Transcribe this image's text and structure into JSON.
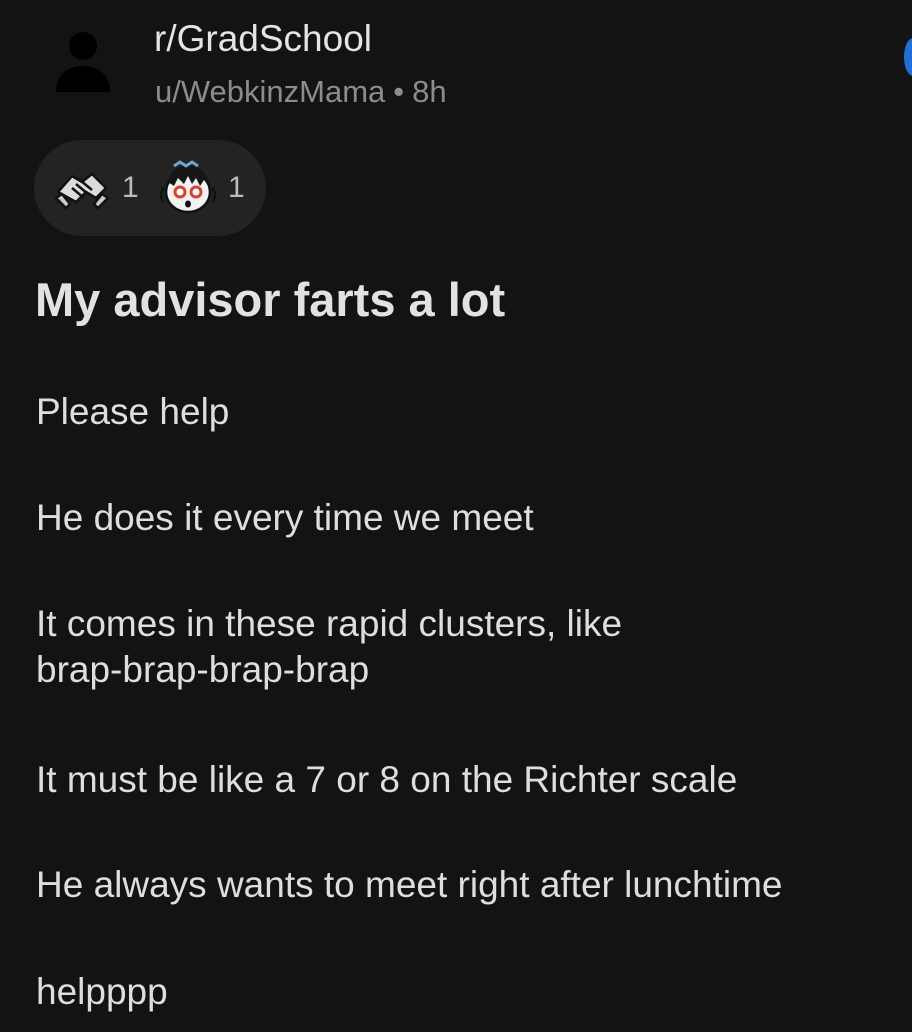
{
  "post": {
    "subreddit": "r/GradSchool",
    "author": "u/WebkinzMama",
    "separator": "•",
    "age": "8h",
    "title": "My advisor farts a lot",
    "body": [
      "Please help",
      "He does it every time we meet",
      "It comes in these rapid clusters, like\nbrap-brap-brap-brap",
      "It must be like a 7 or 8 on the Richter scale",
      "He always wants to meet right after lunchtime",
      "helpppp"
    ]
  },
  "awards": [
    {
      "icon": "handshake-award-icon",
      "count": "1"
    },
    {
      "icon": "shocked-face-award-icon",
      "count": "1"
    }
  ],
  "icons": {
    "avatar": "default-user-avatar-icon"
  },
  "colors": {
    "background": "#131313",
    "award_pill": "#232323",
    "text_primary": "#dedede",
    "text_secondary": "#8c8c8c",
    "accent": "#1f6fd6"
  }
}
